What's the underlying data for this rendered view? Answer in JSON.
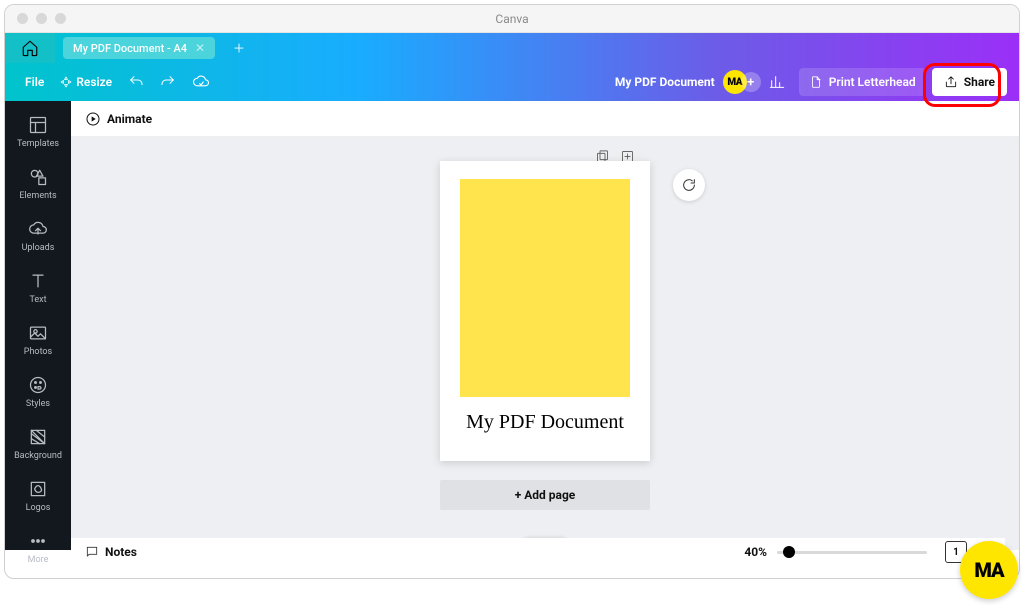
{
  "app_title": "Canva",
  "tab": {
    "label": "My PDF Document - A4"
  },
  "toolbar": {
    "file": "File",
    "resize": "Resize",
    "doc_name": "My PDF Document",
    "avatar": "MA",
    "print": "Print Letterhead",
    "share": "Share"
  },
  "sidebar": {
    "items": [
      {
        "label": "Templates"
      },
      {
        "label": "Elements"
      },
      {
        "label": "Uploads"
      },
      {
        "label": "Text"
      },
      {
        "label": "Photos"
      },
      {
        "label": "Styles"
      },
      {
        "label": "Background"
      },
      {
        "label": "Logos"
      },
      {
        "label": "More"
      }
    ]
  },
  "animate": "Animate",
  "document": {
    "heading": "My PDF Document",
    "add_page": "+ Add page"
  },
  "footer": {
    "notes": "Notes",
    "zoom": "40%",
    "page_indicator": "1"
  },
  "badge": "MA",
  "colors": {
    "yellow": "#ffe44d",
    "accent_yellow": "#ffe600",
    "highlight": "#ff0000"
  }
}
